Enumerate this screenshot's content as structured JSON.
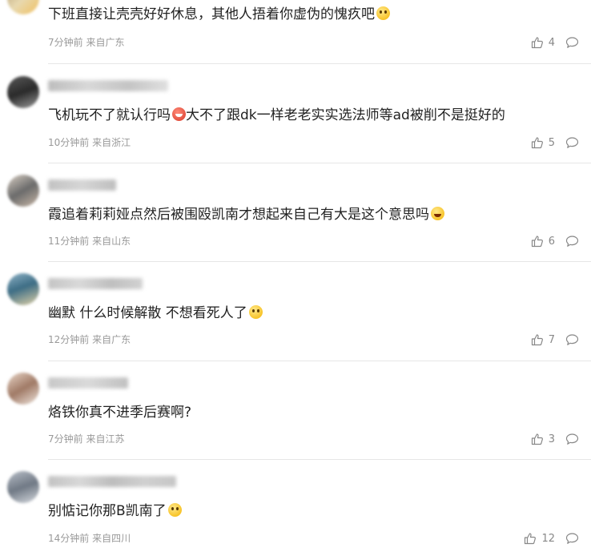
{
  "comments": [
    {
      "content": "下班直接让壳壳好好休息，其他人捂着你虚伪的愧疚吧",
      "emoji": "smile-emoji",
      "time": "7分钟前",
      "location": "来自广东",
      "likes": "4"
    },
    {
      "content_a": "飞机玩不了就认行吗",
      "emoji_a": "devil-emoji",
      "content_b": "大不了跟dk一样老老实实选法师等ad被削不是挺好的",
      "time": "10分钟前",
      "location": "来自浙江",
      "likes": "5"
    },
    {
      "content": "霞追着莉莉娅点然后被围殴凯南才想起来自己有大是这个意思吗",
      "emoji": "laugh-emoji",
      "time": "11分钟前",
      "location": "来自山东",
      "likes": "6"
    },
    {
      "content": "幽默 什么时候解散 不想看死人了",
      "emoji": "smile-emoji",
      "time": "12分钟前",
      "location": "来自广东",
      "likes": "7"
    },
    {
      "content": "烙铁你真不进季后赛啊?",
      "time": "7分钟前",
      "location": "来自江苏",
      "likes": "3"
    },
    {
      "content": "别惦记你那B凯南了",
      "emoji": "smile-emoji",
      "time": "14分钟前",
      "location": "来自四川",
      "likes": "12"
    }
  ],
  "icons": {
    "like": "thumbs-up-icon",
    "reply": "comment-bubble-icon"
  },
  "colors": {
    "meta": "#999999",
    "divider": "#e6e6e6",
    "text": "#222222"
  }
}
